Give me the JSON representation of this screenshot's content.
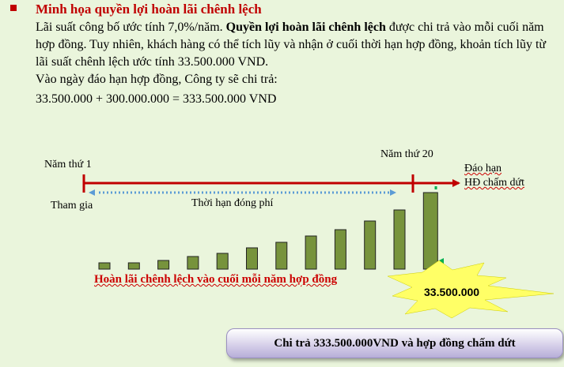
{
  "heading": "Minh họa quyền lợi hoàn lãi chênh lệch",
  "para": {
    "p1_start": "Lãi suất công bố ước tính 7,0%/năm. ",
    "p1_bold": "Quyền lợi hoàn lãi chênh lệch",
    "p1_end": " được chi trả vào mỗi cuối năm hợp đồng. Tuy nhiên, khách hàng có thể tích lũy và nhận ở cuối thời hạn hợp đồng, khoản tích lũy từ lãi suất chênh lệch ước tính 33.500.000 VND.",
    "p2": "Vào ngày đáo hạn hợp đồng, Công ty sẽ chi trả:"
  },
  "calc": "33.500.000 + 300.000.000 = 333.500.000 VND",
  "timeline": {
    "year1": "Năm thứ 1",
    "year20": "Năm thứ 20",
    "maturity_line1": "Đáo hạn",
    "maturity_line2": "HĐ chấm dứt",
    "join": "Tham gia",
    "premium_period": "Thời hạn đóng phí"
  },
  "bars": {
    "relative_heights": [
      0.08,
      0.08,
      0.11,
      0.16,
      0.21,
      0.28,
      0.35,
      0.43,
      0.52,
      0.63,
      0.77,
      1.0
    ],
    "color": "#77933c"
  },
  "refund_label": "Hoàn lãi chênh lệch vào cuối mỗi năm hợp đồng",
  "burst_amount": "33.500.000",
  "payout": "Chi trả 333.500.000VND và hợp đồng chấm dứt",
  "colors": {
    "accent_red": "#c00000",
    "burst_yellow": "#ffff66",
    "dotted_blue": "#5b9bd5",
    "dotted_green": "#00b050"
  }
}
